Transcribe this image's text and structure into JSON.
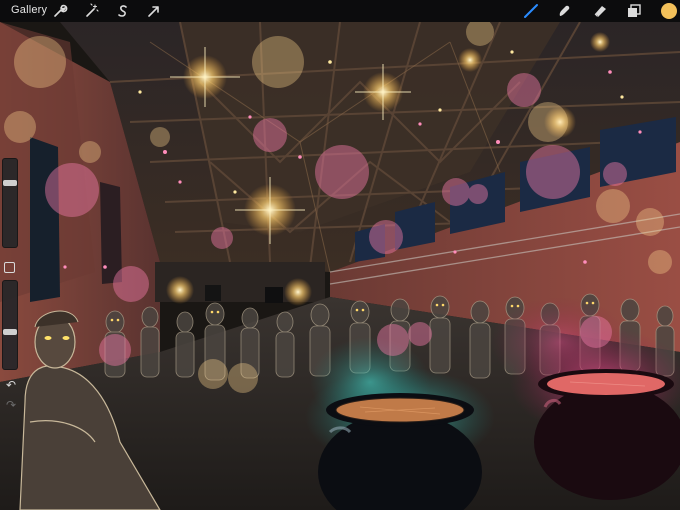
{
  "toolbar": {
    "gallery_label": "Gallery",
    "left_tools": [
      "wrench-icon",
      "magic-wand-icon",
      "selection-s-icon",
      "transform-arrow-icon"
    ],
    "right_tools": [
      "brush-icon",
      "smudge-icon",
      "eraser-icon",
      "layers-icon"
    ],
    "active_tool": "brush-icon",
    "accent_color": "#2a8cff",
    "current_color": "#f3c05a"
  },
  "sidebar": {
    "brush_size_level": 0.74,
    "opacity_level": 0.42,
    "controls": [
      "modify-square-icon",
      "undo-icon",
      "redo-icon"
    ]
  },
  "canvas": {
    "description_colors": {
      "teal_smoke": "#2fb3a8",
      "magenta_smoke": "#c2336d",
      "warm_light": "#ffcf6b"
    }
  }
}
